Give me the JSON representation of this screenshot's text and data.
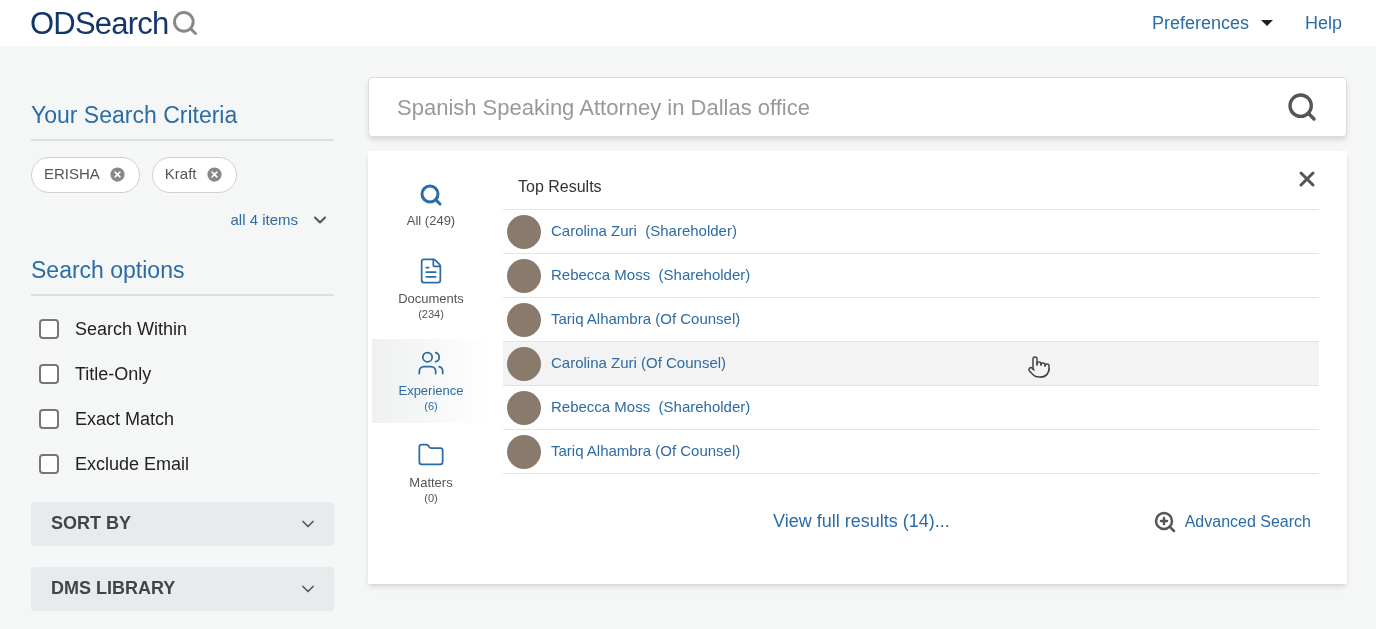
{
  "header": {
    "logo": "ODSearch",
    "nav": [
      {
        "label": "Preferences",
        "kind": "dropdown"
      },
      {
        "label": "Help",
        "kind": "link"
      }
    ]
  },
  "sidebar": {
    "criteria_title": "Your Search Criteria",
    "chips": [
      {
        "label": "ERISHA"
      },
      {
        "label": "Kraft"
      }
    ],
    "show_all": "all 4 items",
    "options_title": "Search options",
    "options": [
      {
        "label": "Search Within",
        "checked": false
      },
      {
        "label": "Title-Only",
        "checked": false
      },
      {
        "label": "Exact Match",
        "checked": false
      },
      {
        "label": "Exclude Email",
        "checked": false
      }
    ],
    "sections": [
      {
        "label": "SORT BY",
        "expanded": false
      },
      {
        "label": "DMS LIBRARY",
        "expanded": false
      }
    ]
  },
  "search": {
    "placeholder": "Spanish Speaking Attorney in Dallas office"
  },
  "results": {
    "categories": [
      {
        "kind": "all",
        "label": "All (249)",
        "selected": false
      },
      {
        "kind": "documents",
        "label": "Documents",
        "count": "(234)",
        "selected": false
      },
      {
        "kind": "experience",
        "label": "Experience",
        "count": "(6)",
        "selected": true
      },
      {
        "kind": "matters",
        "label": "Matters",
        "count": "(0)",
        "selected": false
      }
    ],
    "heading": "Top Results",
    "rows": [
      {
        "name": "Carolina Zuri  (Shareholder)",
        "highlighted": false
      },
      {
        "name": "Rebecca Moss  (Shareholder)",
        "highlighted": false
      },
      {
        "name": "Tariq Alhambra (Of Counsel)",
        "highlighted": false
      },
      {
        "name": "Carolina Zuri (Of Counsel)",
        "highlighted": true
      },
      {
        "name": "Rebecca Moss  (Shareholder)",
        "highlighted": false
      },
      {
        "name": "Tariq Alhambra (Of Counsel)",
        "highlighted": false
      }
    ],
    "view_full": "View full results (14)...",
    "advanced": "Advanced Search"
  }
}
